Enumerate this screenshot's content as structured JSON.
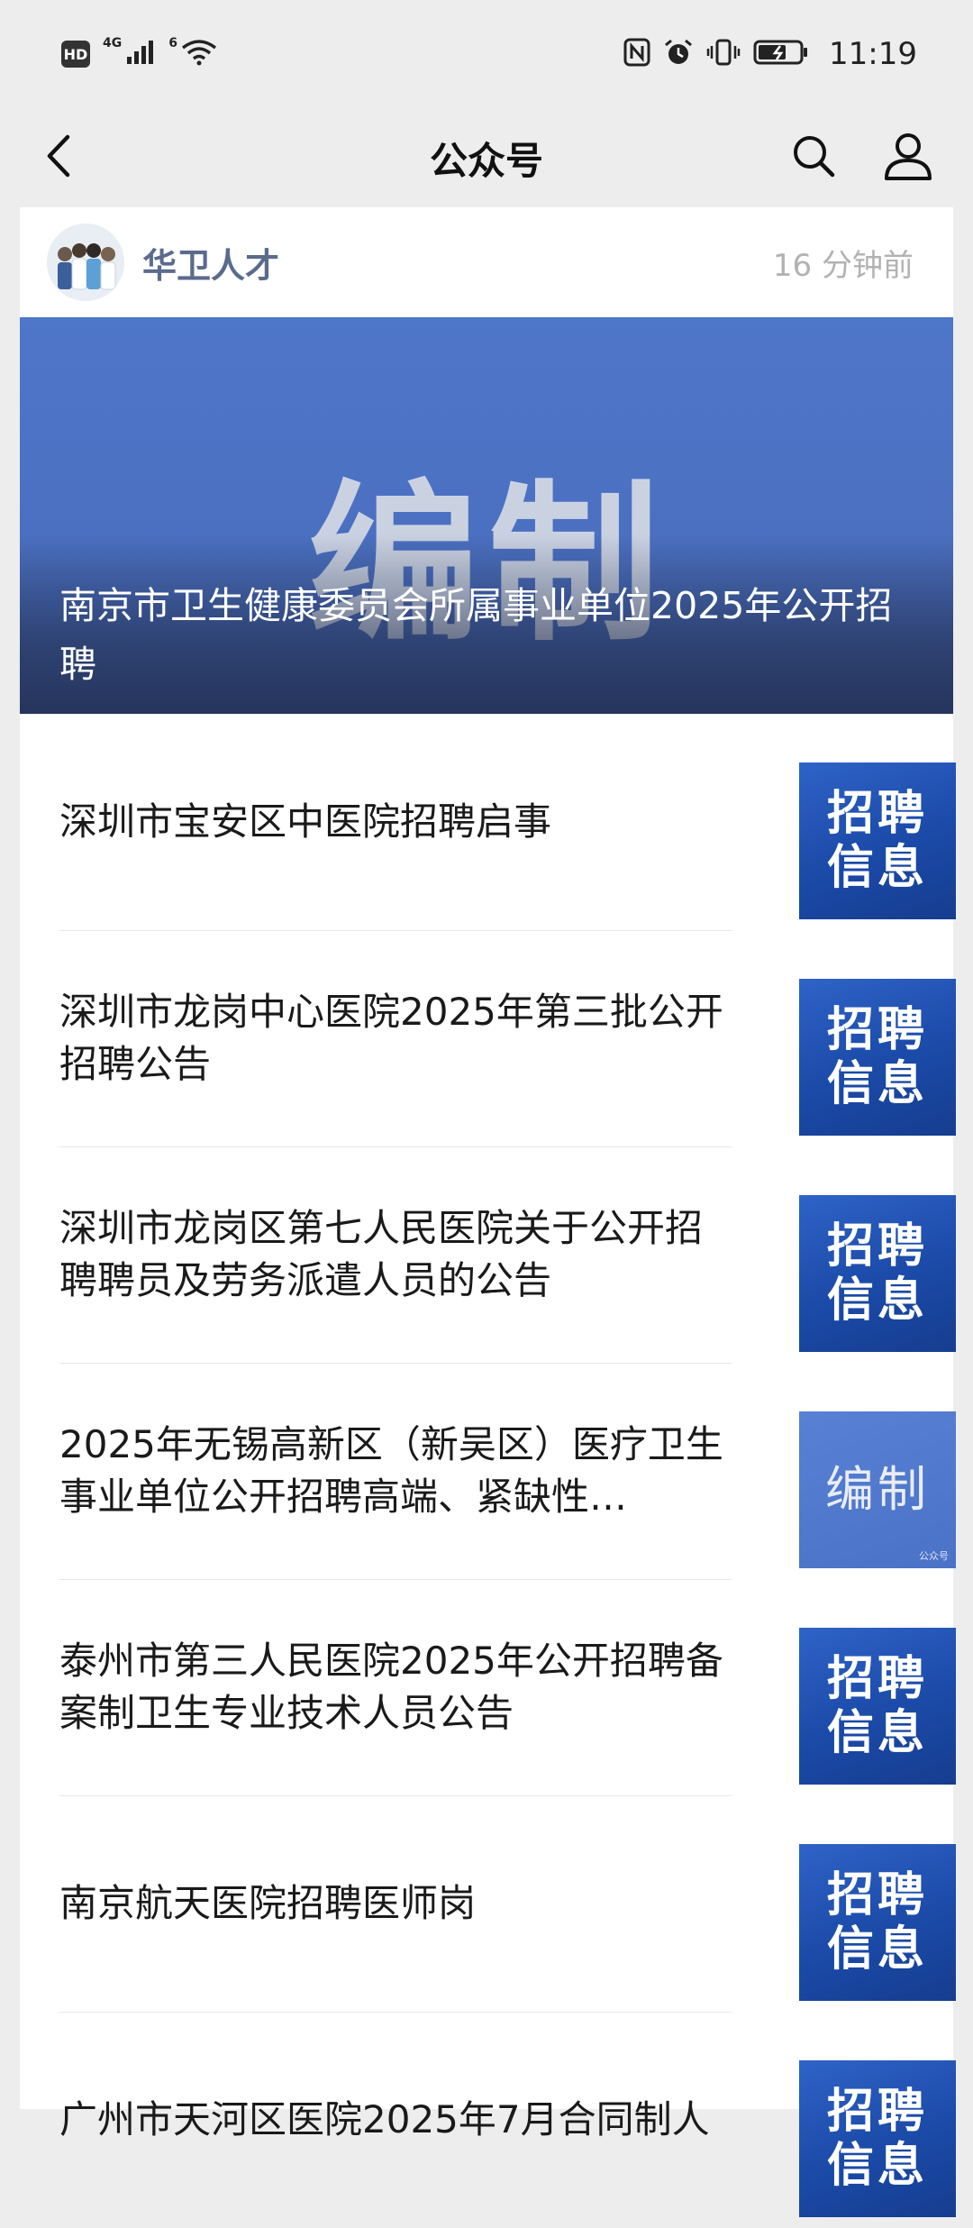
{
  "status_bar": {
    "hd": "HD",
    "signal_label": "4G",
    "wifi_label": "6",
    "time": "11:19"
  },
  "nav": {
    "title": "公众号"
  },
  "account": {
    "name": "华卫人才",
    "time_ago": "16 分钟前"
  },
  "cover": {
    "image_word": "编制",
    "title": "南京市卫生健康委员会所属事业单位2025年公开招聘"
  },
  "articles": [
    {
      "title": "深圳市宝安区中医院招聘启事",
      "thumb_line1": "招聘",
      "thumb_line2": "信息"
    },
    {
      "title": "深圳市龙岗中心医院2025年第三批公开招聘公告",
      "thumb_line1": "招聘",
      "thumb_line2": "信息"
    },
    {
      "title": "深圳市龙岗区第七人民医院关于公开招聘聘员及劳务派遣人员的公告",
      "thumb_line1": "招聘",
      "thumb_line2": "信息"
    },
    {
      "title": "2025年无锡高新区（新吴区）医疗卫生事业单位公开招聘高端、紧缺性…",
      "thumb_line1": "编制",
      "thumb_line2": "",
      "thumb_mark": "公众号"
    },
    {
      "title": "泰州市第三人民医院2025年公开招聘备案制卫生专业技术人员公告",
      "thumb_line1": "招聘",
      "thumb_line2": "信息"
    },
    {
      "title": "南京航天医院招聘医师岗",
      "thumb_line1": "招聘",
      "thumb_line2": "信息"
    },
    {
      "title": "广州市天河区医院2025年7月合同制人",
      "thumb_line1": "招聘",
      "thumb_line2": "信息"
    }
  ],
  "colors": {
    "page_bg": "#ededed",
    "account_name": "#5b6b8c",
    "thumb_blue": "#1b4aa8"
  }
}
